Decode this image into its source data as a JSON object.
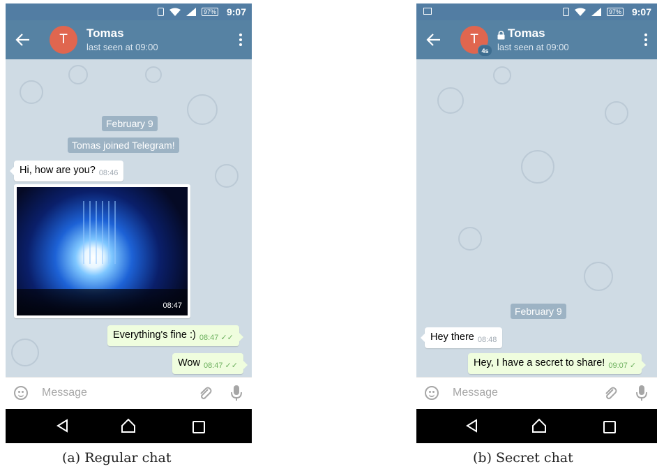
{
  "status_bar": {
    "time": "9:07",
    "battery": "97%"
  },
  "regular_chat": {
    "contact": {
      "initial": "T",
      "name": "Tomas",
      "status": "last seen at 09:00"
    },
    "messages": {
      "date": "February 9",
      "joined": "Tomas joined Telegram!",
      "incoming_1": {
        "text": "Hi, how are you?",
        "time": "08:46"
      },
      "photo": {
        "time": "08:47"
      },
      "outgoing_1": {
        "text": "Everything's fine :)",
        "time": "08:47"
      },
      "outgoing_2": {
        "text": "Wow",
        "time": "08:47"
      }
    },
    "input_placeholder": "Message",
    "caption": "(a) Regular chat"
  },
  "secret_chat": {
    "contact": {
      "initial": "T",
      "name": "Tomas",
      "status": "last seen at 09:00",
      "timer": "4s"
    },
    "messages": {
      "date": "February 9",
      "incoming_1": {
        "text": "Hey there",
        "time": "08:48"
      },
      "outgoing_1": {
        "text": "Hey, I have a secret to share!",
        "time": "09:07"
      }
    },
    "input_placeholder": "Message",
    "caption": "(b) Secret chat"
  },
  "icons": {
    "back": "arrow-left-icon",
    "menu": "more-vertical-icon",
    "emoji": "smiley-icon",
    "attach": "paperclip-icon",
    "mic": "microphone-icon",
    "lock": "lock-icon",
    "nav_back": "triangle-back-icon",
    "nav_home": "home-icon",
    "nav_recents": "recents-icon"
  },
  "colors": {
    "header": "#5682a3",
    "statusbar": "#527da3",
    "avatar": "#e0664f",
    "out_bubble": "#effdde",
    "chat_bg": "#cfdbe4",
    "check": "#6cb05d"
  }
}
